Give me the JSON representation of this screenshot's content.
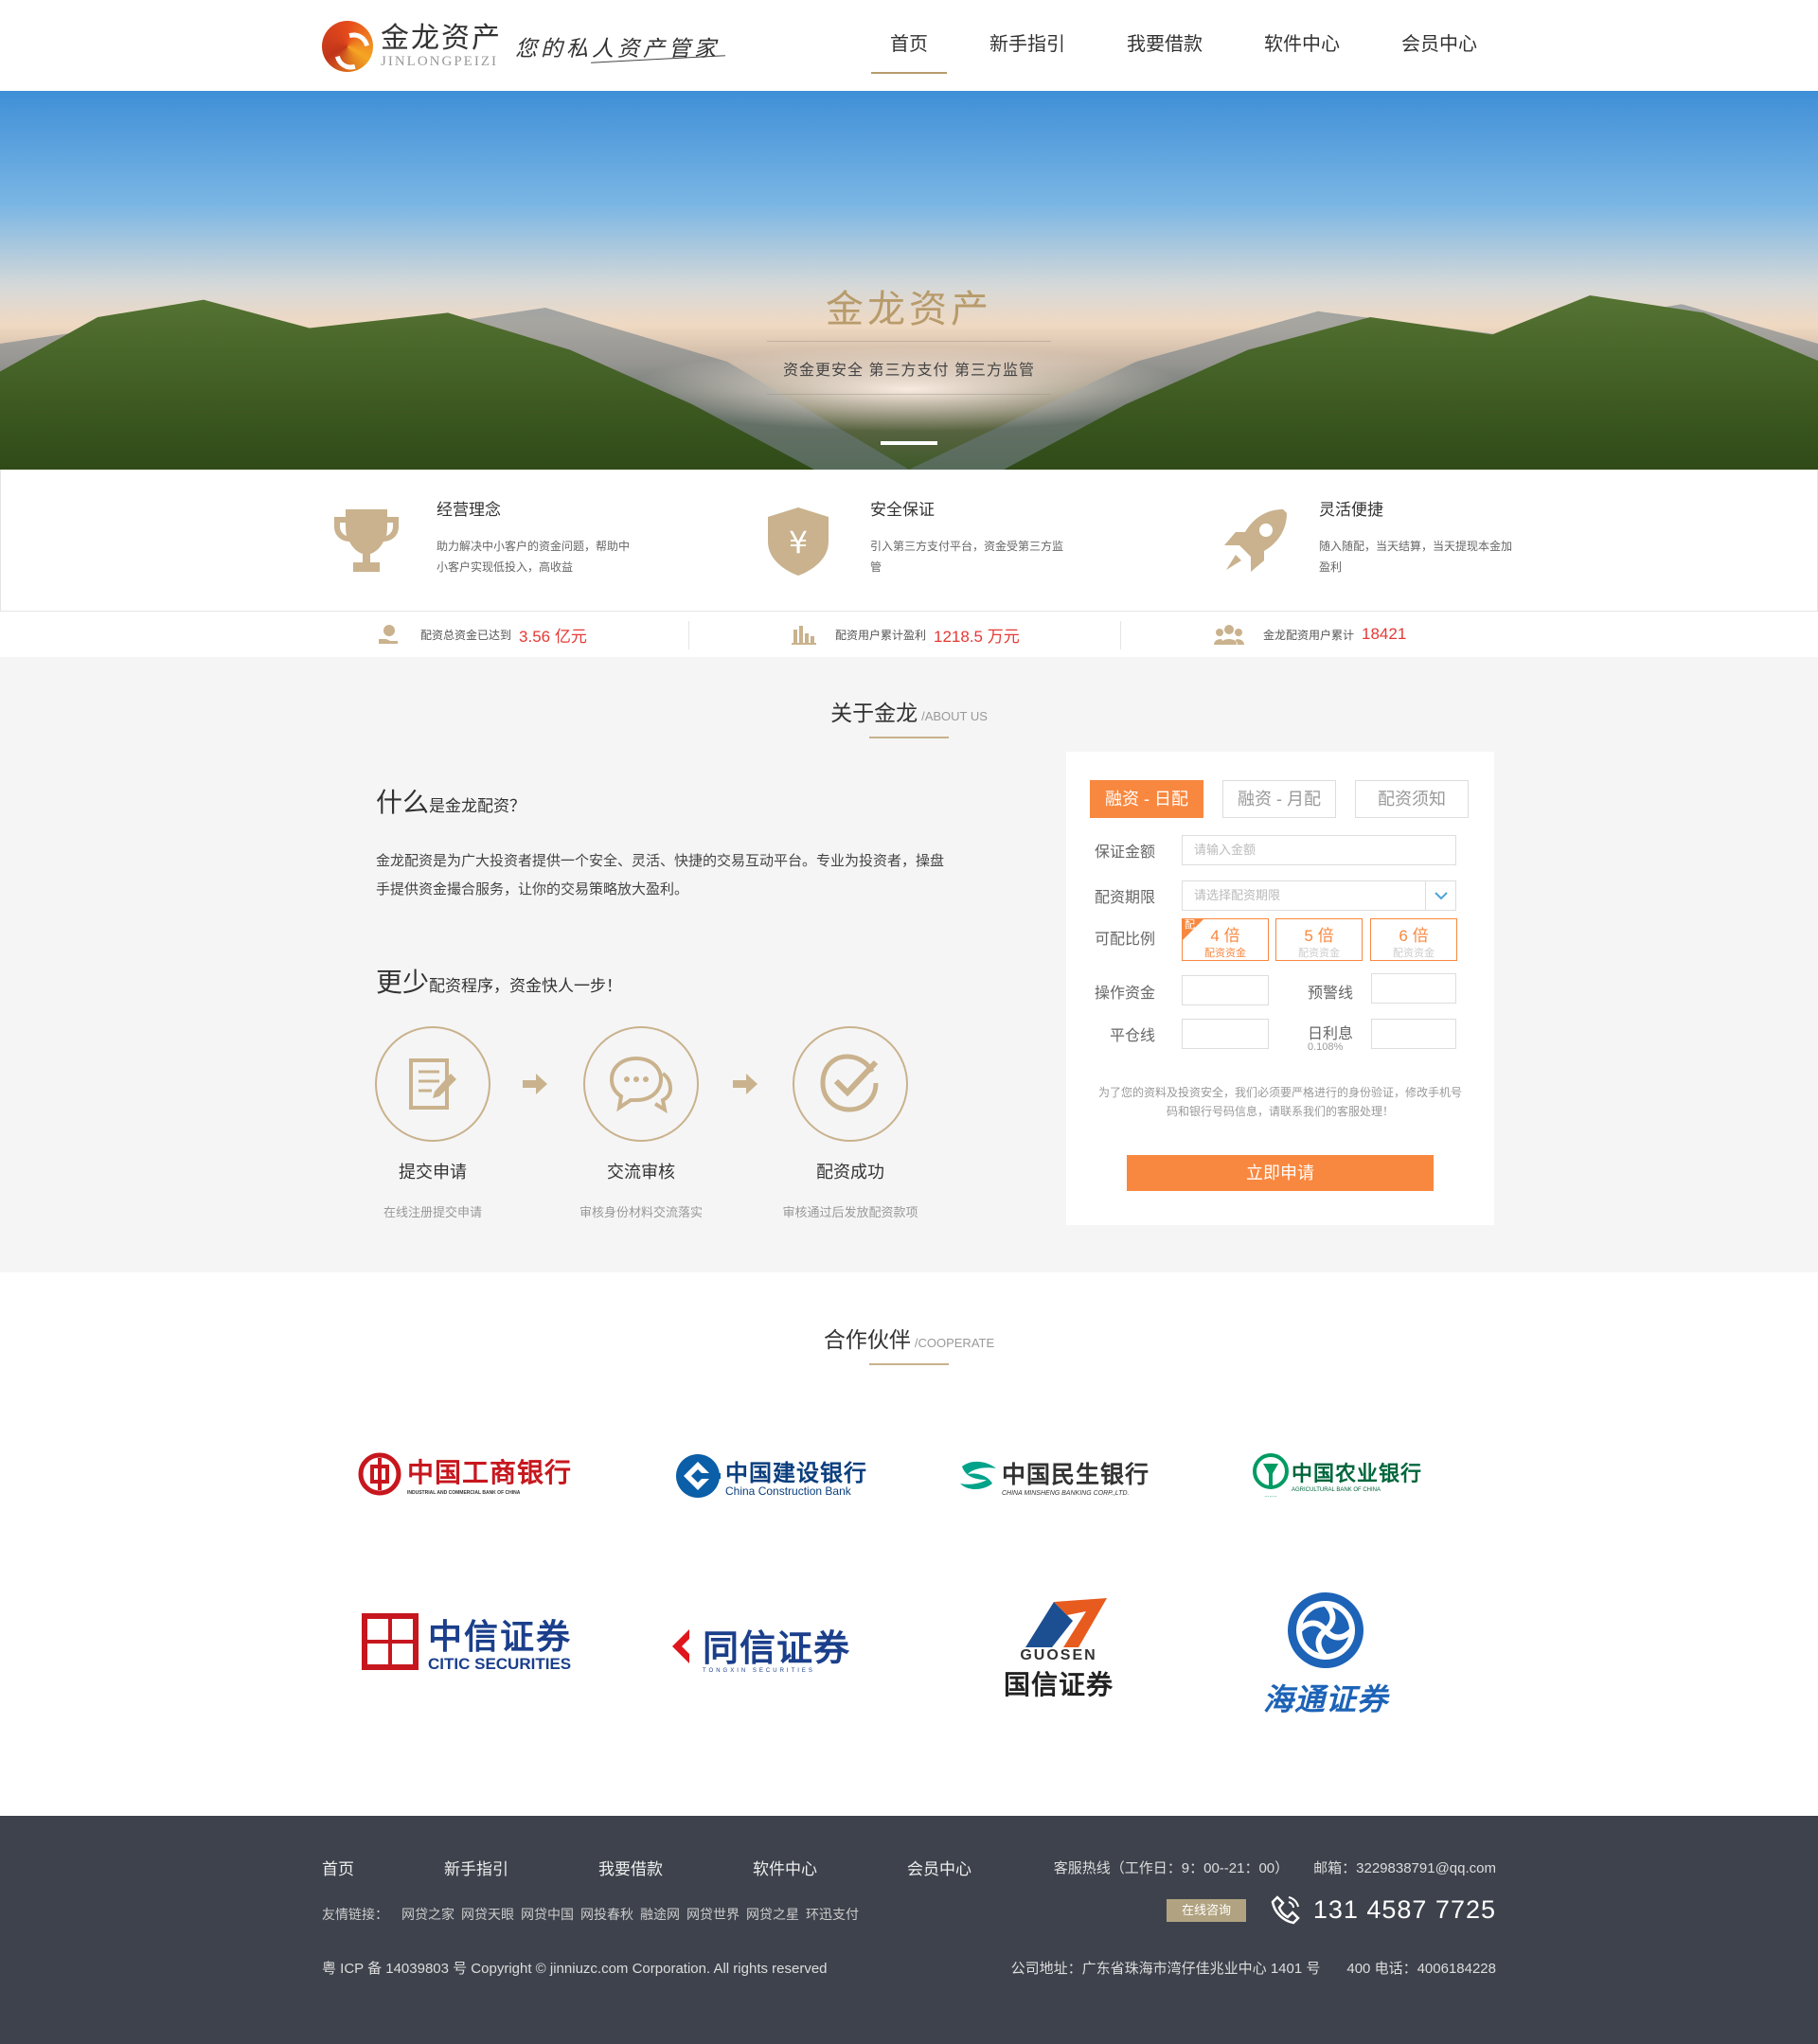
{
  "header": {
    "logo_cn": "金龙资产",
    "logo_en": "JINLONGPEIZI",
    "slogan": "您的私人资产管家",
    "nav": [
      "首页",
      "新手指引",
      "我要借款",
      "软件中心",
      "会员中心"
    ]
  },
  "banner": {
    "title": "金龙资产",
    "subtitle": "资金更安全    第三方支付    第三方监管"
  },
  "features": [
    {
      "title": "经营理念",
      "desc": "助力解决中小客户的资金问题，帮助中小客户实现低投入，高收益",
      "icon": "trophy-icon"
    },
    {
      "title": "安全保证",
      "desc": "引入第三方支付平台，资金受第三方监管",
      "icon": "shield-yen-icon"
    },
    {
      "title": "灵活便捷",
      "desc": "随入随配，当天结算，当天提现本金加盈利",
      "icon": "rocket-icon"
    }
  ],
  "stats": [
    {
      "label": "配资总资金已达到",
      "value": "3.56 亿元",
      "icon": "money-hand-icon"
    },
    {
      "label": "配资用户累计盈利",
      "value": "1218.5 万元",
      "icon": "bar-chart-icon"
    },
    {
      "label": "金龙配资用户累计",
      "value": "18421",
      "icon": "users-icon"
    }
  ],
  "about": {
    "title": "关于金龙",
    "title_en": "/ABOUT US",
    "q1_big": "什么",
    "q1_small": "是金龙配资？",
    "desc": "金龙配资是为广大投资者提供一个安全、灵活、快捷的交易互动平台。专业为投资者，操盘手提供资金撮合服务，让你的交易策略放大盈利。",
    "q2_big": "更少",
    "q2_small": "配资程序，资金快人一步！",
    "steps": [
      {
        "title": "提交申请",
        "desc": "在线注册提交申请",
        "icon": "document-edit-icon"
      },
      {
        "title": "交流审核",
        "desc": "审核身份材料交流落实",
        "icon": "chat-icon"
      },
      {
        "title": "配资成功",
        "desc": "审核通过后发放配资款项",
        "icon": "check-circle-icon"
      }
    ]
  },
  "form": {
    "tabs": [
      "融资 - 日配",
      "融资 - 月配",
      "配资须知"
    ],
    "deposit_label": "保证金额",
    "deposit_placeholder": "请输入金额",
    "period_label": "配资期限",
    "period_placeholder": "请选择配资期限",
    "ratio_label": "可配比例",
    "ratio_corner": "配",
    "ratios": [
      {
        "value": "4 倍",
        "sub": "配资资金"
      },
      {
        "value": "5 倍",
        "sub": "配资资金"
      },
      {
        "value": "6 倍",
        "sub": "配资资金"
      }
    ],
    "op_fund_label": "操作资金",
    "warn_label": "预警线",
    "close_label": "平仓线",
    "rate_label": "日利息",
    "rate_value": "0.108%",
    "note": "为了您的资料及投资安全，我们必须要严格进行的身份验证，修改手机号码和银行号码信息，请联系我们的客服处理！",
    "submit": "立即申请"
  },
  "partners": {
    "title": "合作伙伴",
    "title_en": "/COOPERATE",
    "logos": [
      {
        "name": "中国工商银行",
        "en": "INDUSTRIAL AND COMMERCIAL BANK OF CHINA"
      },
      {
        "name": "中国建设银行",
        "en": "China Construction Bank"
      },
      {
        "name": "中国民生银行",
        "en": "CHINA MINSHENG BANKING CORP.,LTD."
      },
      {
        "name": "中国农业银行",
        "en": "AGRICULTURAL BANK OF CHINA"
      },
      {
        "name": "中信证券",
        "en": "CITIC SECURITIES"
      },
      {
        "name": "同信证券",
        "en": "TONGXIN SECURITIES"
      },
      {
        "name": "国信证券",
        "en": "GUOSEN"
      },
      {
        "name": "海通证券",
        "en": ""
      }
    ]
  },
  "footer": {
    "nav": [
      "首页",
      "新手指引",
      "我要借款",
      "软件中心",
      "会员中心"
    ],
    "links_label": "友情链接：",
    "links": [
      "网贷之家",
      "网贷天眼",
      "网贷中国",
      "网投春秋",
      "融途网",
      "网贷世界",
      "网贷之星",
      "环迅支付"
    ],
    "copyright": "粤 ICP 备 14039803 号 Copyright © jinniuzc.com Corporation. All rights reserved",
    "hotline": "客服热线（工作日：9：00--21：00）",
    "email": "邮箱：3229838791@qq.com",
    "online": "在线咨询",
    "phone": "131 4587 7725",
    "address": "公司地址：广东省珠海市湾仔佳兆业中心 1401 号",
    "tel400": "400 电话：4006184228"
  },
  "colors": {
    "accent": "#f8883f",
    "gold": "#b89b6b",
    "red": "#e53935",
    "footer_bg": "#3e424c"
  }
}
